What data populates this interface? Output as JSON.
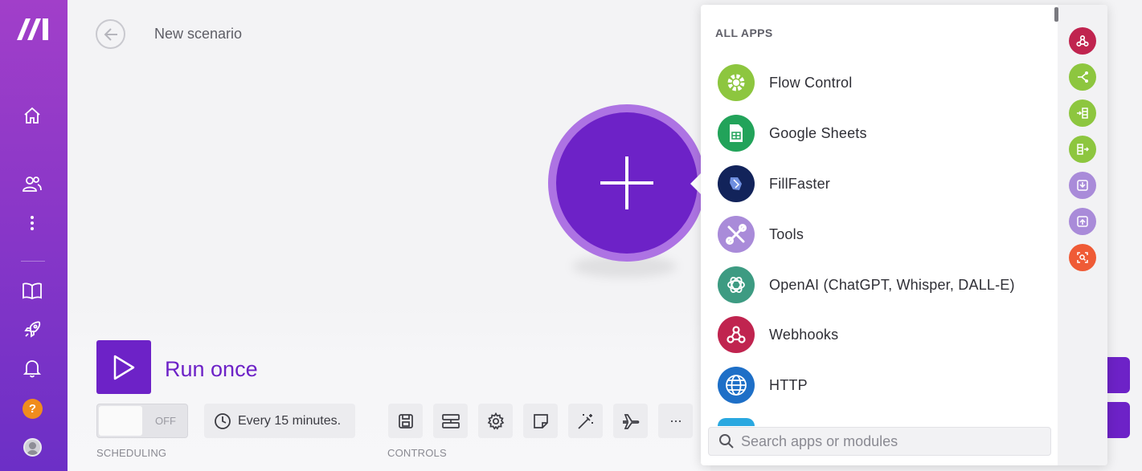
{
  "header": {
    "title": "New scenario"
  },
  "canvas": {
    "add_module_symbol": "+"
  },
  "toolbar": {
    "run_label": "Run once",
    "toggle_state": "OFF",
    "schedule_text": "Every 15 minutes.",
    "scheduling_caption": "SCHEDULING",
    "controls_caption": "CONTROLS",
    "more_symbol": "···"
  },
  "help": {
    "symbol": "?"
  },
  "panel": {
    "heading": "ALL APPS",
    "apps": [
      {
        "label": "Flow Control",
        "icon": "gear-icon",
        "color": "#8dc63f"
      },
      {
        "label": "Google Sheets",
        "icon": "spreadsheet-icon",
        "color": "#22a35a"
      },
      {
        "label": "FillFaster",
        "icon": "fillfaster-icon",
        "color": "#12235a"
      },
      {
        "label": "Tools",
        "icon": "tools-icon",
        "color": "#a98bd9"
      },
      {
        "label": "OpenAI (ChatGPT, Whisper, DALL-E)",
        "icon": "openai-icon",
        "color": "#3d9b82"
      },
      {
        "label": "Webhooks",
        "icon": "webhook-icon",
        "color": "#c0244f"
      },
      {
        "label": "HTTP",
        "icon": "globe-icon",
        "color": "#1e6fc7"
      }
    ],
    "search_placeholder": "Search apps or modules",
    "quick_filters": [
      {
        "icon": "webhook-icon",
        "color": "#c0244f"
      },
      {
        "icon": "router-icon",
        "color": "#8dc63f"
      },
      {
        "icon": "aggregator-icon",
        "color": "#8dc63f"
      },
      {
        "icon": "iterator-icon",
        "color": "#8dc63f"
      },
      {
        "icon": "download-icon",
        "color": "#a98bd9"
      },
      {
        "icon": "upload-icon",
        "color": "#a98bd9"
      },
      {
        "icon": "search-add-icon",
        "color": "#ef5b36"
      }
    ]
  }
}
